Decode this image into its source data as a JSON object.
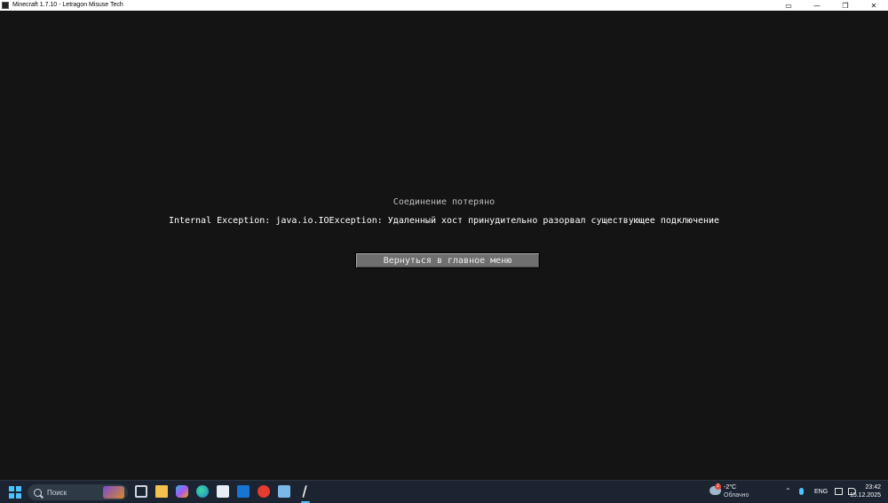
{
  "window": {
    "title": "Minecraft 1.7.10 - Letragon Misuse Tech",
    "controls": {
      "capture": "▭",
      "minimize": "—",
      "restore": "❐",
      "close": "✕"
    }
  },
  "screen": {
    "heading": "Соединение потеряно",
    "message": "Internal Exception: java.io.IOException: Удаленный хост принудительно разорвал существующее подключение",
    "button_label": "Вернуться в главное меню"
  },
  "taskbar": {
    "search_placeholder": "Поиск",
    "pinned_icons": [
      "task-view-icon",
      "file-explorer-icon",
      "copilot-icon",
      "edge-icon",
      "microsoft-store-icon",
      "yandex-browser-icon",
      "outlook-icon",
      "mail-icon",
      "minecraft-launcher-icon"
    ],
    "weather": {
      "badge": "2",
      "temperature": "-2°C",
      "condition": "Облачно"
    },
    "language": "ENG",
    "clock": {
      "time": "23:42",
      "date": "15.12.2025"
    },
    "accent": "#4cc2ff"
  }
}
